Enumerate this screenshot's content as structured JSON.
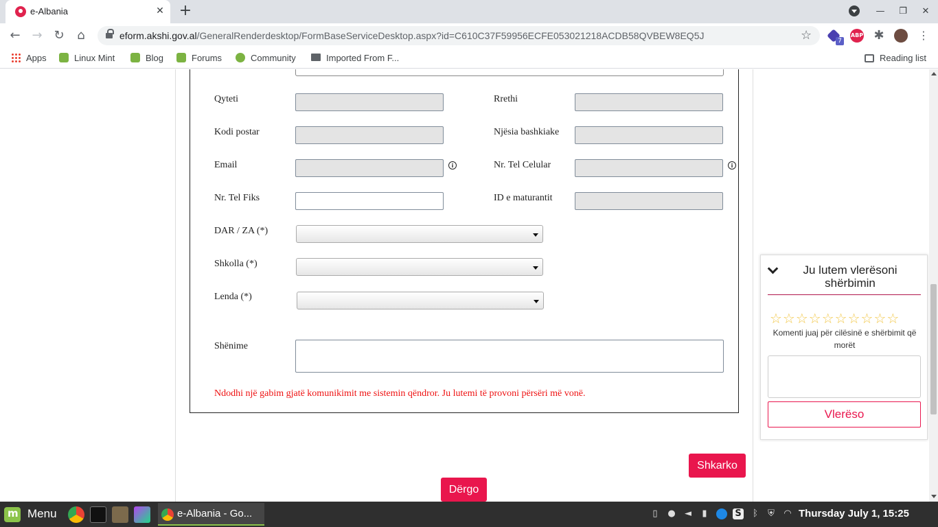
{
  "browser": {
    "tab_title": "e-Albania",
    "tab_close": "✕",
    "new_tab": "+",
    "url_host": "eform.akshi.gov.al",
    "url_path": "/GeneralRenderdesktop/FormBaseServiceDesktop.aspx?id=C610C37F59956ECFE053021218ACDB58QVBEW8EQ5J",
    "extension_badge": "7",
    "abp_label": "ABP",
    "window_controls": {
      "minimize": "—",
      "maximize": "❐",
      "close": "✕"
    }
  },
  "bookmarks": {
    "items": [
      {
        "label": "Apps",
        "icon": "apps-grid-icon"
      },
      {
        "label": "Linux Mint",
        "icon": "linux-mint-icon"
      },
      {
        "label": "Blog",
        "icon": "linux-mint-icon"
      },
      {
        "label": "Forums",
        "icon": "linux-mint-icon"
      },
      {
        "label": "Community",
        "icon": "community-icon"
      },
      {
        "label": "Imported From F...",
        "icon": "folder-icon"
      }
    ],
    "reading_list": "Reading list"
  },
  "form": {
    "fields": {
      "qyteti": "Qyteti",
      "rrethi": "Rrethi",
      "kodi_postar": "Kodi postar",
      "njesia": "Njësia bashkiake",
      "email": "Email",
      "tel_celular": "Nr. Tel Celular",
      "tel_fiks": "Nr. Tel Fiks",
      "id_maturantit": "ID e maturantit",
      "dar_za": "DAR / ZA (*)",
      "shkolla": "Shkolla (*)",
      "lenda": "Lenda (*)",
      "shenime": "Shënime"
    },
    "info_glyph": "i",
    "error_message": "Ndodhi një gabim gjatë komunikimit me sistemin qëndror. Ju lutemi të provoni përsëri më vonë.",
    "download_button": "Shkarko",
    "submit_button": "Dërgo"
  },
  "rating": {
    "title": "Ju lutem vlerësoni shërbimin",
    "stars": "☆☆☆☆☆☆☆☆☆☆",
    "star_count": 10,
    "comment_label": "Komenti juaj për cilësinë e shërbimit që morët",
    "button": "Vlerëso"
  },
  "taskbar": {
    "menu_label": "Menu",
    "window_label": "e-Albania - Go...",
    "clock": "Thursday July  1, 15:25",
    "launchers": [
      "chrome-icon",
      "terminal-icon",
      "sublime-icon",
      "phpstorm-icon"
    ]
  },
  "colors": {
    "accent": "#e9164d",
    "error": "#ee1111",
    "star": "#f2c84b",
    "mint_green": "#8bc34a"
  }
}
